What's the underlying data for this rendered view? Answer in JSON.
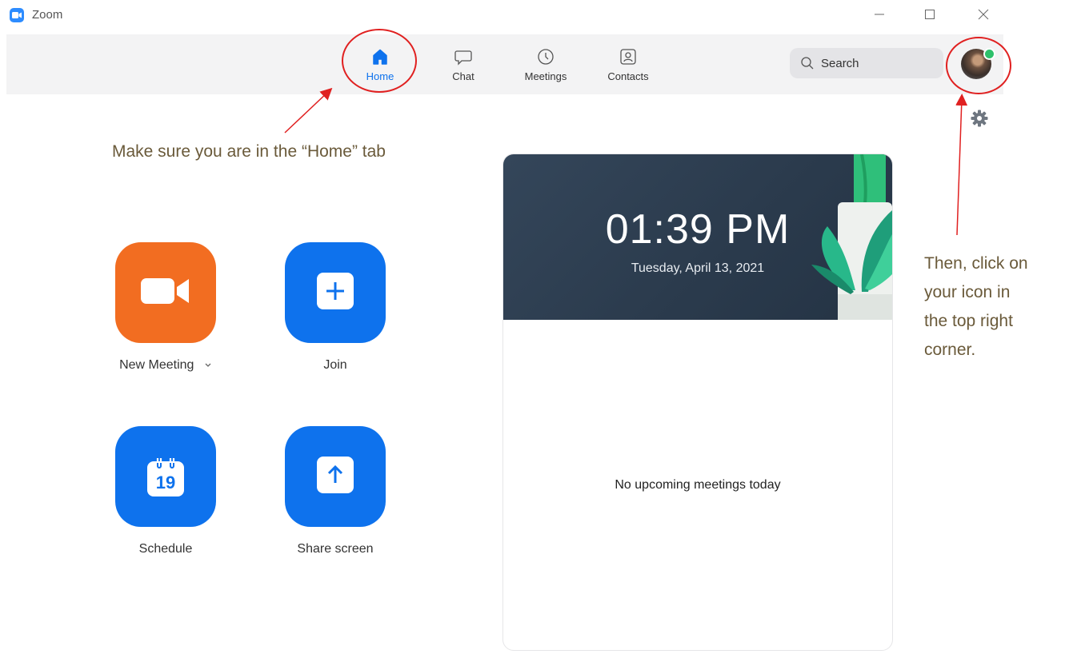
{
  "window": {
    "title": "Zoom"
  },
  "nav": {
    "tabs": [
      {
        "label": "Home",
        "active": true
      },
      {
        "label": "Chat",
        "active": false
      },
      {
        "label": "Meetings",
        "active": false
      },
      {
        "label": "Contacts",
        "active": false
      }
    ]
  },
  "search": {
    "placeholder": "Search"
  },
  "actions": {
    "new_meeting": "New Meeting",
    "join": "Join",
    "schedule": "Schedule",
    "schedule_day": "19",
    "share_screen": "Share screen"
  },
  "calendar_panel": {
    "time": "01:39 PM",
    "date": "Tuesday, April 13, 2021",
    "empty_message": "No upcoming meetings today"
  },
  "annotations": {
    "home_tab_note": "Make sure you are in the “Home” tab",
    "avatar_note_lines": [
      "Then, click on",
      "your icon in",
      "the top right",
      "corner."
    ]
  },
  "colors": {
    "accent": "#0e72ed",
    "new_meeting": "#f26d21",
    "presence": "#2ec06b",
    "annotation": "#e02020"
  }
}
